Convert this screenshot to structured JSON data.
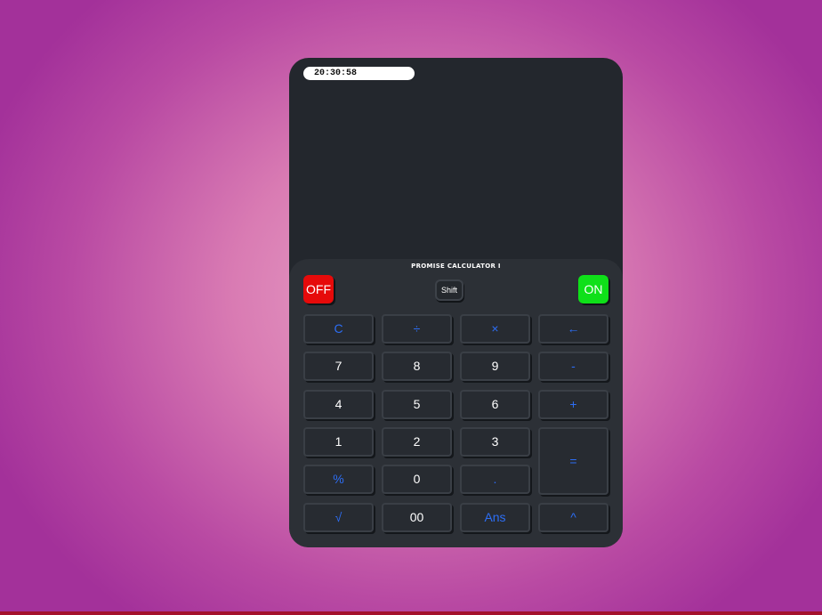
{
  "clock": {
    "time": "20:30:58"
  },
  "calculator": {
    "brand": "PROMISE CALCULATOR I",
    "off_label": "OFF",
    "shift_label": "Shift",
    "on_label": "ON",
    "colors": {
      "body": "#23272d",
      "keypad": "#2c3036",
      "operator_text": "#2d6ef5",
      "off": "#e60a0a",
      "on": "#0fe019"
    },
    "keys": [
      {
        "name": "clear-key",
        "label": "C",
        "kind": "op"
      },
      {
        "name": "divide-key",
        "label": "÷",
        "kind": "op"
      },
      {
        "name": "multiply-key",
        "label": "×",
        "kind": "op"
      },
      {
        "name": "backspace-key",
        "label": "←",
        "kind": "op"
      },
      {
        "name": "digit-7-key",
        "label": "7",
        "kind": "num"
      },
      {
        "name": "digit-8-key",
        "label": "8",
        "kind": "num"
      },
      {
        "name": "digit-9-key",
        "label": "9",
        "kind": "num"
      },
      {
        "name": "minus-key",
        "label": "-",
        "kind": "op"
      },
      {
        "name": "digit-4-key",
        "label": "4",
        "kind": "num"
      },
      {
        "name": "digit-5-key",
        "label": "5",
        "kind": "num"
      },
      {
        "name": "digit-6-key",
        "label": "6",
        "kind": "num"
      },
      {
        "name": "plus-key",
        "label": "+",
        "kind": "op"
      },
      {
        "name": "digit-1-key",
        "label": "1",
        "kind": "num"
      },
      {
        "name": "digit-2-key",
        "label": "2",
        "kind": "num"
      },
      {
        "name": "digit-3-key",
        "label": "3",
        "kind": "num"
      },
      {
        "name": "equals-key",
        "label": "=",
        "kind": "op"
      },
      {
        "name": "percent-key",
        "label": "%",
        "kind": "op"
      },
      {
        "name": "digit-0-key",
        "label": "0",
        "kind": "num"
      },
      {
        "name": "decimal-key",
        "label": ".",
        "kind": "op"
      },
      {
        "name": "sqrt-key",
        "label": "√",
        "kind": "op"
      },
      {
        "name": "double-zero-key",
        "label": "00",
        "kind": "num"
      },
      {
        "name": "ans-key",
        "label": "Ans",
        "kind": "op"
      },
      {
        "name": "power-key",
        "label": "^",
        "kind": "op"
      }
    ]
  }
}
